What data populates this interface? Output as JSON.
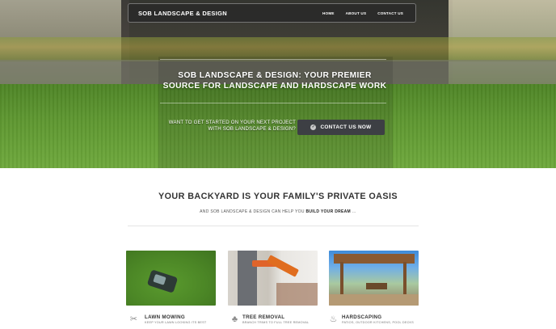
{
  "navbar": {
    "brand": "SOB LANDSCAPE & DESIGN",
    "links": [
      {
        "label": "HOME"
      },
      {
        "label": "ABOUT US"
      },
      {
        "label": "CONTACT US"
      }
    ]
  },
  "hero": {
    "title_line1": "SOB LANDSCAPE & DESIGN: YOUR PREMIER",
    "title_line2": "SOURCE FOR LANDSCAPE AND HARDSCAPE WORK",
    "cta_text_line1": "WANT TO GET STARTED ON YOUR NEXT PROJECT",
    "cta_text_line2": "WITH SOB LANDSCAPE & DESIGN?",
    "cta_button": "CONTACT US NOW",
    "cta_icon": "check-circle-icon"
  },
  "section": {
    "title": "YOUR BACKYARD IS YOUR FAMILY'S PRIVATE OASIS",
    "subtitle_prefix": "AND SOB LANDSCAPE & DESIGN CAN HELP YOU",
    "subtitle_bold": "BUILD YOUR DREAM",
    "subtitle_suffix": "..."
  },
  "services": [
    {
      "title": "LAWN MOWING",
      "desc": "KEEP YOUR LAWN LOOKING ITS BEST",
      "icon": "tools-icon"
    },
    {
      "title": "TREE REMOVAL",
      "desc": "BRANCH TRIMS TO FULL TREE REMOVAL",
      "icon": "tree-icon"
    },
    {
      "title": "HARDSCAPING",
      "desc": "PATIOS, OUTDOOR KITCHENS, POOL DECKS",
      "icon": "flame-icon"
    }
  ],
  "colors": {
    "navbar_bg": "#282828",
    "button_bg": "#3d3f44",
    "heading": "#333333"
  }
}
